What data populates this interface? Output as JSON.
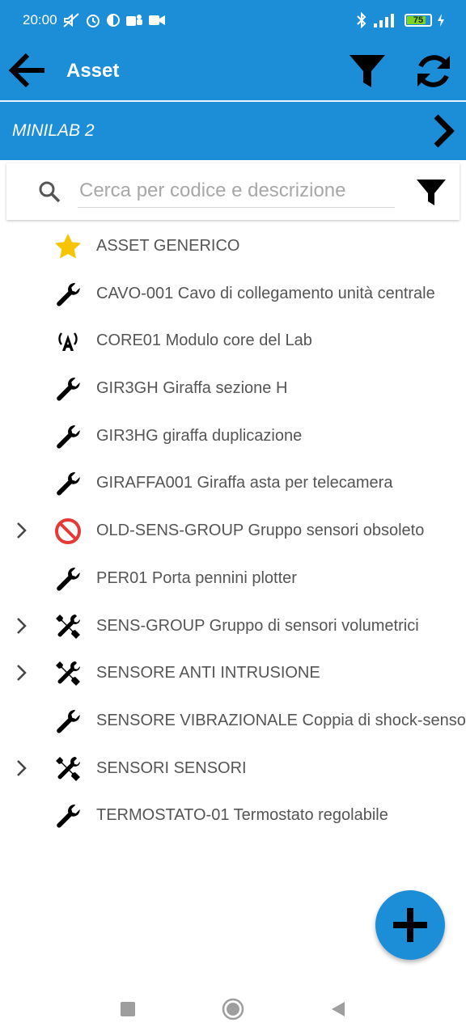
{
  "status_bar": {
    "time": "20:00",
    "battery": "75"
  },
  "app_bar": {
    "title": "Asset"
  },
  "location": {
    "label": "MINILAB 2"
  },
  "search": {
    "placeholder": "Cerca per codice e descrizione",
    "value": ""
  },
  "list": {
    "items": [
      {
        "icon": "star-icon",
        "expandable": false,
        "text": "ASSET GENERICO"
      },
      {
        "icon": "wrench-icon",
        "expandable": false,
        "text": "CAVO-001 Cavo di collegamento unità centrale"
      },
      {
        "icon": "antenna-icon",
        "expandable": false,
        "text": "CORE01 Modulo core del Lab"
      },
      {
        "icon": "wrench-icon",
        "expandable": false,
        "text": "GIR3GH Giraffa sezione H"
      },
      {
        "icon": "wrench-icon",
        "expandable": false,
        "text": "GIR3HG giraffa duplicazione"
      },
      {
        "icon": "wrench-icon",
        "expandable": false,
        "text": "GIRAFFA001 Giraffa asta per telecamera"
      },
      {
        "icon": "prohibited-icon",
        "expandable": true,
        "text": "OLD-SENS-GROUP Gruppo sensori obsoleto"
      },
      {
        "icon": "wrench-icon",
        "expandable": false,
        "text": "PER01 Porta pennini plotter"
      },
      {
        "icon": "tools-icon",
        "expandable": true,
        "text": "SENS-GROUP Gruppo di sensori volumetrici"
      },
      {
        "icon": "tools-icon",
        "expandable": true,
        "text": "SENSORE ANTI INTRUSIONE"
      },
      {
        "icon": "wrench-icon",
        "expandable": false,
        "text": "SENSORE VIBRAZIONALE Coppia di shock-sensor"
      },
      {
        "icon": "tools-icon",
        "expandable": true,
        "text": "SENSORI SENSORI"
      },
      {
        "icon": "wrench-icon",
        "expandable": false,
        "text": "TERMOSTATO-01 Termostato regolabile"
      }
    ]
  },
  "colors": {
    "primary": "#1c8ed8",
    "star": "#f6c400",
    "prohibited": "#e53935",
    "text": "#555555"
  }
}
